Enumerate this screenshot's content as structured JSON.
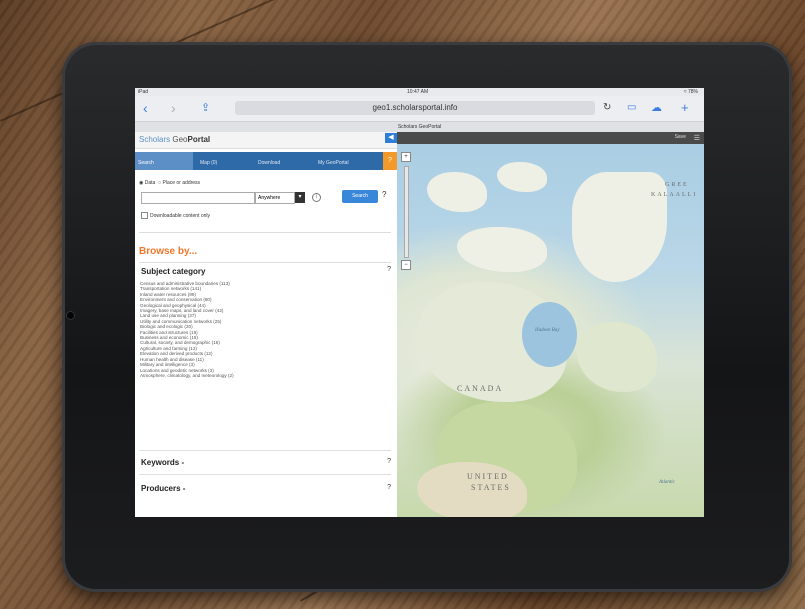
{
  "statusbar": {
    "carrier": "iPad",
    "time": "10:47 AM",
    "battery": "≈ 78%"
  },
  "browser": {
    "url": "geo1.scholarsportal.info",
    "tab_title": "Scholars GeoPortal"
  },
  "brand": {
    "part1": "Scholars",
    "part2": "Geo",
    "part3": "Portal"
  },
  "tabs": [
    {
      "label": "Search"
    },
    {
      "label": "Map (0)"
    },
    {
      "label": "Download"
    },
    {
      "label": "My GeoPortal"
    }
  ],
  "tab_help": "?",
  "search": {
    "option_data": "Data",
    "option_place": "Place or address",
    "anywhere": "Anywhere",
    "button": "Search",
    "help": "?",
    "downloadable": "Downloadable content only",
    "info": "i"
  },
  "browse": {
    "heading": "Browse by..."
  },
  "sections": {
    "subject": "Subject category",
    "keywords": "Keywords -",
    "producers": "Producers -",
    "help": "?"
  },
  "categories": [
    "Census and administrative boundaries (113)",
    "Transportation networks (141)",
    "Inland water resources (99)",
    "Environment and conservation (80)",
    "Geological and geophysical (44)",
    "Imagery, base maps, and land cover (42)",
    "Land use and planning (37)",
    "Utility and communication networks (25)",
    "Biologic and ecologic (20)",
    "Facilities and structures (19)",
    "Business and economic (18)",
    "Cultural, society, and demographic (16)",
    "Agriculture and farming (12)",
    "Elevation and derived products (12)",
    "Human health and disease (11)",
    "Military and intelligence (3)",
    "Locations and geodetic networks (3)",
    "Atmosphere, climatology, and meteorology (2)"
  ],
  "map": {
    "label_canada": "CANADA",
    "label_us_1": "UNITED",
    "label_us_2": "STATES",
    "label_bay": "Hudson Bay",
    "label_atlantic": "Atlantic",
    "label_greenland_1": "GREE",
    "label_greenland_2": "KALAALLI",
    "save_label": "Save",
    "zoom_in": "+",
    "zoom_out": "−",
    "toggle": "◀"
  },
  "colors": {
    "accent": "#2f6aa8",
    "orange": "#f39a2b",
    "search_button": "#3a86d8"
  }
}
